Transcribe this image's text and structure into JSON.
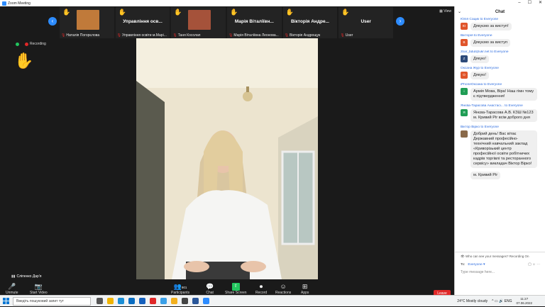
{
  "window": {
    "title": "Zoom Meeting",
    "min": "–",
    "max": "☐",
    "close": "✕"
  },
  "gallery": {
    "view_label": "View",
    "prev": "‹",
    "next": "›",
    "tiles": [
      {
        "name": "",
        "label": "Наталія Погорєлова",
        "has_avatar": true,
        "avatar_color": "#c07a3a"
      },
      {
        "name": "Управління осв...",
        "label": "Управління освіти м.Марі...",
        "has_avatar": false
      },
      {
        "name": "",
        "label": "Таня Косолап",
        "has_avatar": true,
        "avatar_color": "#a5523a"
      },
      {
        "name": "Марія Віталіївн...",
        "label": "Марія Віталіївна Леонова...",
        "has_avatar": false
      },
      {
        "name": "Вікторія Андре...",
        "label": "Вікторія Андрощук",
        "has_avatar": false
      },
      {
        "name": "User",
        "label": "User",
        "has_avatar": false
      }
    ]
  },
  "status": {
    "recording": "Recording"
  },
  "self_view": {
    "name": "Сліпенко Дар'я"
  },
  "toolbar": {
    "unmute": "Unmute",
    "start_video": "Start Video",
    "participants": "Participants",
    "participants_count": "901",
    "chat": "Chat",
    "share_screen": "Share Screen",
    "record": "Record",
    "reactions": "Reactions",
    "apps": "Apps",
    "leave": "Leave"
  },
  "chat": {
    "title": "Chat",
    "messages": [
      {
        "sender": "Юлія Сацик to Everyone",
        "initials": "Ю",
        "color": "#e0552b",
        "text": "Дякуємо за виступ!"
      },
      {
        "sender": "Вікторія to Everyone",
        "initials": "В",
        "color": "#e0552b",
        "text": "Дякуємо за виступ"
      },
      {
        "sender": "zbar_bdut@ukr.net to Everyone",
        "initials": "Z",
        "color": "#2d4a7a",
        "text": "Дякую!"
      },
      {
        "sender": "Оксана Жур to Everyone",
        "initials": "О",
        "color": "#e0552b",
        "text": "Дякую!"
      },
      {
        "sender": "iPhoneОксана to Everyone",
        "initials": "i",
        "color": "#1f9d55",
        "text": "Армія Мова, Віра! Наш гімн тому є підтвердження!"
      },
      {
        "sender": "Янєва-Тарасова Анастасі... to Everyone",
        "initials": "Я",
        "color": "#1f9d55",
        "text": "Янєва-Тарасова А.В. КЗШ №123 м. Кривий Ріг всім доброго дня"
      },
      {
        "sender": "Віктор Вірко to Everyone",
        "initials": "",
        "color": "#8a6a4a",
        "text": "Добрий день! Вас вітає Державний професійно-технічний навчальний заклад «Криворізький центр професійної освіти робітничих кадрів торгівлі та ресторанного сервісу» викладач Віктор Вірко!"
      },
      {
        "sender": "",
        "initials": "",
        "color": "",
        "text": "м. Кривий Ріг"
      }
    ],
    "warning": "Who can see your messages? Recording On",
    "to_label": "To:",
    "to_value": "Everyone ▾",
    "placeholder": "Type message here..."
  },
  "taskbar": {
    "search_placeholder": "Введіть пошуковий запит тут",
    "weather": "24°C  Mostly cloudy",
    "time": "11:27",
    "date": "07.06.2022"
  }
}
